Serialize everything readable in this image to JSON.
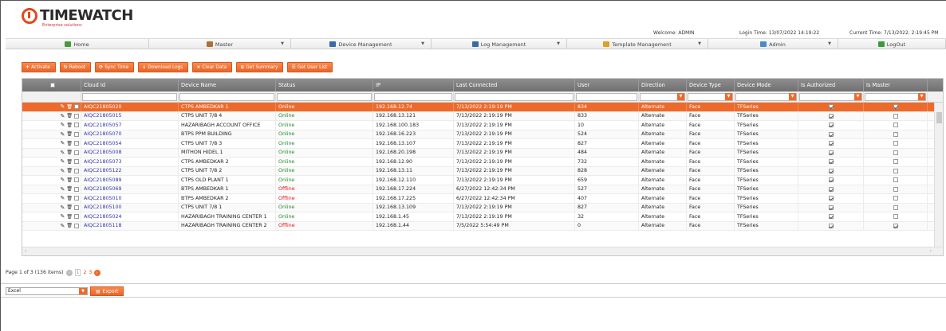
{
  "brand": {
    "name": "TIMEWATCH",
    "tagline": "Enterprise solutions"
  },
  "header": {
    "welcome": "Welcome: ADMIN",
    "login_time": "Login Time: 13/07/2022 14:19:22",
    "current_time": "Current Time: 7/13/2022, 2:19:45 PM"
  },
  "menu": [
    {
      "label": "Home",
      "icon": "home-icon",
      "color": "#4a9a3a"
    },
    {
      "label": "Master",
      "icon": "master-icon",
      "color": "#b07030"
    },
    {
      "label": "Device Management",
      "icon": "device-icon",
      "color": "#3a6aa8"
    },
    {
      "label": "Log Management",
      "icon": "log-icon",
      "color": "#3a6aa8"
    },
    {
      "label": "Template Management",
      "icon": "template-icon",
      "color": "#e0a020"
    },
    {
      "label": "Admin",
      "icon": "admin-icon",
      "color": "#4a8ac8"
    },
    {
      "label": "LogOut",
      "icon": "logout-icon",
      "color": "#3a9a3a"
    }
  ],
  "toolbar": [
    "Activate",
    "Reboot",
    "Sync Time",
    "Download Logs",
    "Clear Data",
    "Get Summary",
    "Get User List"
  ],
  "columns": [
    "",
    "Cloud Id",
    "Device Name",
    "Status",
    "IP",
    "Last Connected",
    "User",
    "Direction",
    "Device Type",
    "Device Mode",
    "Is Authorized",
    "Is Master"
  ],
  "rows": [
    {
      "id": "AIQC21805020",
      "name": "CTPS AMBEDKAR 1",
      "status": "Online",
      "ip": "192.168.12.74",
      "last": "7/13/2022 2:19:19 PM",
      "user": "834",
      "dir": "Alternate",
      "type": "Face",
      "mode": "TFSeries",
      "auth": true,
      "master": true
    },
    {
      "id": "AIQC21805015",
      "name": "CTPS UNIT 7/8 4",
      "status": "Online",
      "ip": "192.168.13.121",
      "last": "7/13/2022 2:19:19 PM",
      "user": "833",
      "dir": "Alternate",
      "type": "Face",
      "mode": "TFSeries",
      "auth": true,
      "master": false
    },
    {
      "id": "AIQC21805057",
      "name": "HAZARIBAGH ACCOUNT OFFICE",
      "status": "Online",
      "ip": "192.168.100.183",
      "last": "7/13/2022 2:19:19 PM",
      "user": "10",
      "dir": "Alternate",
      "type": "Face",
      "mode": "TFSeries",
      "auth": true,
      "master": false
    },
    {
      "id": "AIQC21805070",
      "name": "BTPS PPM BUILDING",
      "status": "Online",
      "ip": "192.168.16.223",
      "last": "7/13/2022 2:19:19 PM",
      "user": "524",
      "dir": "Alternate",
      "type": "Face",
      "mode": "TFSeries",
      "auth": true,
      "master": false
    },
    {
      "id": "AIQC21805054",
      "name": "CTPS UNIT 7/8 3",
      "status": "Online",
      "ip": "192.168.13.107",
      "last": "7/13/2022 2:19:19 PM",
      "user": "827",
      "dir": "Alternate",
      "type": "Face",
      "mode": "TFSeries",
      "auth": true,
      "master": false
    },
    {
      "id": "AIQC21805008",
      "name": "MITHON HIDEL 1",
      "status": "Online",
      "ip": "192.168.20.198",
      "last": "7/13/2022 2:19:19 PM",
      "user": "484",
      "dir": "Alternate",
      "type": "Face",
      "mode": "TFSeries",
      "auth": true,
      "master": false
    },
    {
      "id": "AIQC21805073",
      "name": "CTPS AMBEDKAR 2",
      "status": "Online",
      "ip": "192.168.12.90",
      "last": "7/13/2022 2:19:19 PM",
      "user": "732",
      "dir": "Alternate",
      "type": "Face",
      "mode": "TFSeries",
      "auth": true,
      "master": false
    },
    {
      "id": "AIQC21805122",
      "name": "CTPS UNIT 7/8 2",
      "status": "Online",
      "ip": "192.168.13.11",
      "last": "7/13/2022 2:19:19 PM",
      "user": "828",
      "dir": "Alternate",
      "type": "Face",
      "mode": "TFSeries",
      "auth": true,
      "master": false
    },
    {
      "id": "AIQC21805089",
      "name": "CTPS OLD PLANT 1",
      "status": "Online",
      "ip": "192.168.12.110",
      "last": "7/13/2022 2:19:19 PM",
      "user": "659",
      "dir": "Alternate",
      "type": "Face",
      "mode": "TFSeries",
      "auth": true,
      "master": false
    },
    {
      "id": "AIQC21805069",
      "name": "BTPS AMBEDKAR 1",
      "status": "Offline",
      "ip": "192.168.17.224",
      "last": "6/27/2022 12:42:34 PM",
      "user": "527",
      "dir": "Alternate",
      "type": "Face",
      "mode": "TFSeries",
      "auth": true,
      "master": false
    },
    {
      "id": "AIQC21805010",
      "name": "BTPS AMBEDKAR 2",
      "status": "Offline",
      "ip": "192.168.17.225",
      "last": "6/27/2022 12:42:34 PM",
      "user": "407",
      "dir": "Alternate",
      "type": "Face",
      "mode": "TFSeries",
      "auth": true,
      "master": false
    },
    {
      "id": "AIQC21805100",
      "name": "CTPS UNIT 7/8 1",
      "status": "Online",
      "ip": "192.168.13.109",
      "last": "7/13/2022 2:19:19 PM",
      "user": "827",
      "dir": "Alternate",
      "type": "Face",
      "mode": "TFSeries",
      "auth": true,
      "master": false
    },
    {
      "id": "AIQC21805024",
      "name": "HAZARIBAGH TRAINING CENTER 1",
      "status": "Online",
      "ip": "192.168.1.45",
      "last": "7/13/2022 2:19:19 PM",
      "user": "32",
      "dir": "Alternate",
      "type": "Face",
      "mode": "TFSeries",
      "auth": true,
      "master": false
    },
    {
      "id": "AIQC21805118",
      "name": "HAZARIBAGH TRAINING CENTER 2",
      "status": "Offline",
      "ip": "192.168.1.44",
      "last": "7/5/2022 5:54:49 PM",
      "user": "0",
      "dir": "Alternate",
      "type": "Face",
      "mode": "TFSeries",
      "auth": true,
      "master": true
    }
  ],
  "pager": {
    "info": "Page 1 of 3 (136 items)",
    "pages": [
      "1",
      "2",
      "3"
    ]
  },
  "export": {
    "format": "Excel",
    "button": "Export"
  }
}
